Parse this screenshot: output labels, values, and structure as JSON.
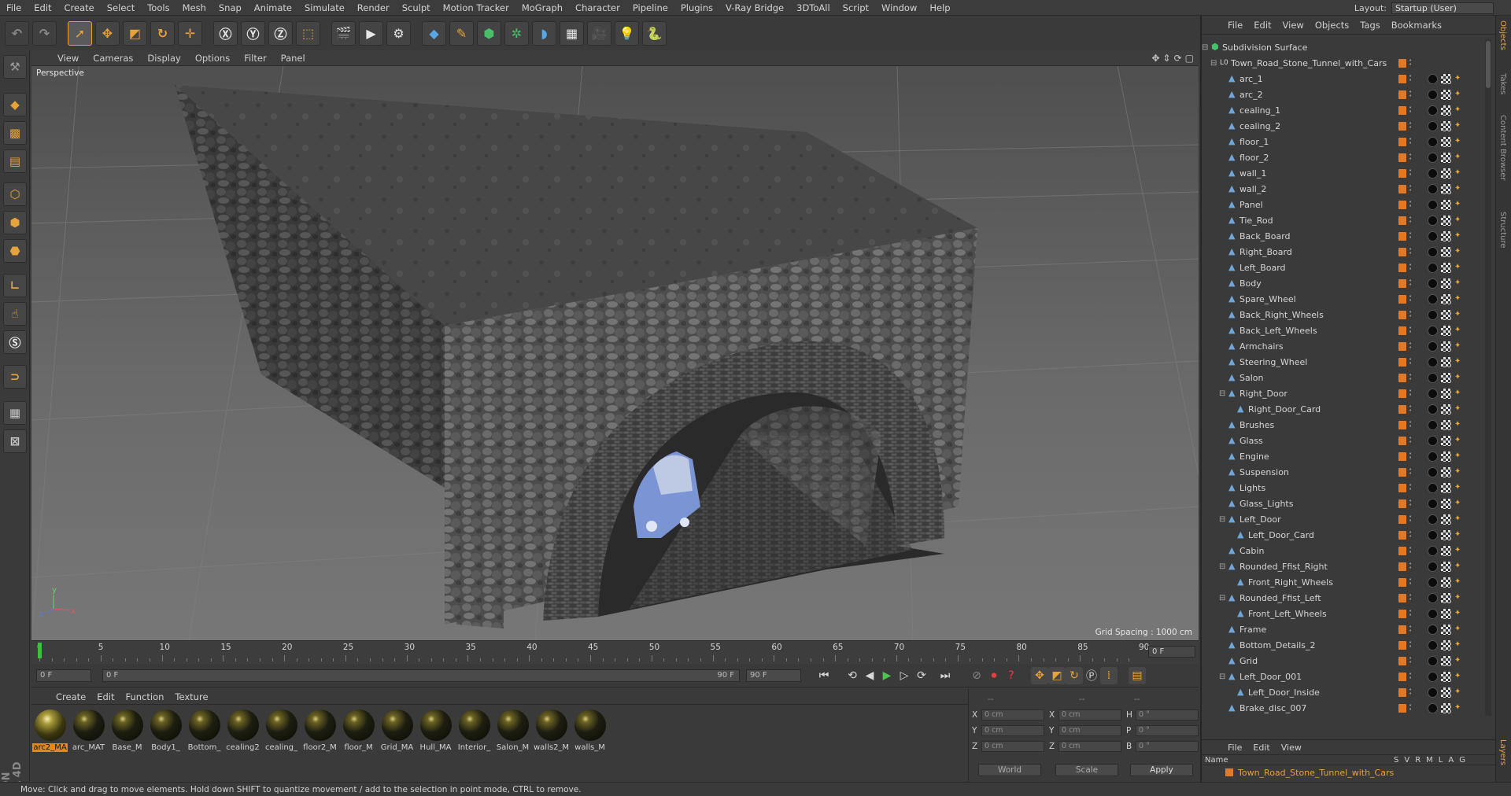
{
  "menu": [
    "File",
    "Edit",
    "Create",
    "Select",
    "Tools",
    "Mesh",
    "Snap",
    "Animate",
    "Simulate",
    "Render",
    "Sculpt",
    "Motion Tracker",
    "MoGraph",
    "Character",
    "Pipeline",
    "Plugins",
    "V-Ray Bridge",
    "3DToAll",
    "Script",
    "Window",
    "Help"
  ],
  "layout": {
    "label": "Layout:",
    "value": "Startup (User)"
  },
  "viewport": {
    "menu": [
      "View",
      "Cameras",
      "Display",
      "Options",
      "Filter",
      "Panel"
    ],
    "label": "Perspective",
    "grid_spacing": "Grid Spacing : 1000 cm"
  },
  "timeline": {
    "ticks": [
      "0",
      "5",
      "10",
      "15",
      "20",
      "25",
      "30",
      "35",
      "40",
      "45",
      "50",
      "55",
      "60",
      "65",
      "70",
      "75",
      "80",
      "85",
      "90"
    ],
    "current_frame": "0 F"
  },
  "transport": {
    "start_field": "0 F",
    "range_start": "0 F",
    "range_end": "90 F",
    "end_field": "90 F"
  },
  "material_menu": [
    "Create",
    "Edit",
    "Function",
    "Texture"
  ],
  "materials": [
    "arc2_MA",
    "arc_MAT",
    "Base_M",
    "Body1_",
    "Bottom_",
    "cealing2",
    "cealing_",
    "floor2_M",
    "floor_M",
    "Grid_MA",
    "Hull_MA",
    "Interior_",
    "Salon_M",
    "walls2_M",
    "walls_M"
  ],
  "attributes": {
    "header": "--",
    "pos_labels": [
      "X",
      "Y",
      "Z"
    ],
    "size_labels": [
      "X",
      "Y",
      "Z"
    ],
    "rot_labels": [
      "H",
      "P",
      "B"
    ],
    "pos_values": [
      "0 cm",
      "0 cm",
      "0 cm"
    ],
    "size_values": [
      "0 cm",
      "0 cm",
      "0 cm"
    ],
    "rot_values": [
      "0 °",
      "0 °",
      "0 °"
    ],
    "coord_system": "World",
    "mode": "Scale",
    "apply": "Apply"
  },
  "status": "Move: Click and drag to move elements. Hold down SHIFT to quantize movement / add to the selection in point mode, CTRL to remove.",
  "objects_menu": [
    "File",
    "Edit",
    "View",
    "Objects",
    "Tags",
    "Bookmarks"
  ],
  "tree": [
    {
      "name": "Subdivision Surface",
      "level": 0
    },
    {
      "name": "Town_Road_Stone_Tunnel_with_Cars",
      "level": 1
    },
    {
      "name": "arc_1",
      "level": 2
    },
    {
      "name": "arc_2",
      "level": 2
    },
    {
      "name": "cealing_1",
      "level": 2
    },
    {
      "name": "cealing_2",
      "level": 2
    },
    {
      "name": "floor_1",
      "level": 2
    },
    {
      "name": "floor_2",
      "level": 2
    },
    {
      "name": "wall_1",
      "level": 2
    },
    {
      "name": "wall_2",
      "level": 2
    },
    {
      "name": "Panel",
      "level": 2
    },
    {
      "name": "Tie_Rod",
      "level": 2
    },
    {
      "name": "Back_Board",
      "level": 2
    },
    {
      "name": "Right_Board",
      "level": 2
    },
    {
      "name": "Left_Board",
      "level": 2
    },
    {
      "name": "Body",
      "level": 2
    },
    {
      "name": "Spare_Wheel",
      "level": 2
    },
    {
      "name": "Back_Right_Wheels",
      "level": 2
    },
    {
      "name": "Back_Left_Wheels",
      "level": 2
    },
    {
      "name": "Armchairs",
      "level": 2
    },
    {
      "name": "Steering_Wheel",
      "level": 2
    },
    {
      "name": "Salon",
      "level": 2
    },
    {
      "name": "Right_Door",
      "level": 2
    },
    {
      "name": "Right_Door_Card",
      "level": 3
    },
    {
      "name": "Brushes",
      "level": 2
    },
    {
      "name": "Glass",
      "level": 2
    },
    {
      "name": "Engine",
      "level": 2
    },
    {
      "name": "Suspension",
      "level": 2
    },
    {
      "name": "Lights",
      "level": 2
    },
    {
      "name": "Glass_Lights",
      "level": 2
    },
    {
      "name": "Left_Door",
      "level": 2
    },
    {
      "name": "Left_Door_Card",
      "level": 3
    },
    {
      "name": "Cabin",
      "level": 2
    },
    {
      "name": "Rounded_Ffist_Right",
      "level": 2
    },
    {
      "name": "Front_Right_Wheels",
      "level": 3
    },
    {
      "name": "Rounded_Ffist_Left",
      "level": 2
    },
    {
      "name": "Front_Left_Wheels",
      "level": 3
    },
    {
      "name": "Frame",
      "level": 2
    },
    {
      "name": "Bottom_Details_2",
      "level": 2
    },
    {
      "name": "Grid",
      "level": 2
    },
    {
      "name": "Left_Door_001",
      "level": 2
    },
    {
      "name": "Left_Door_Inside",
      "level": 3
    },
    {
      "name": "Brake_disc_007",
      "level": 2
    }
  ],
  "layers": {
    "menu": [
      "File",
      "Edit",
      "View"
    ],
    "header_name": "Name",
    "header_cols": [
      "S",
      "V",
      "R",
      "M",
      "L",
      "A",
      "G"
    ],
    "row": "Town_Road_Stone_Tunnel_with_Cars"
  },
  "side_tabs": [
    "Objects",
    "Takes",
    "Content Browser",
    "Structure",
    "Layers"
  ],
  "colors": {
    "accent": "#e8a23a",
    "object_color": "#e07a28",
    "layer_text": "#e8a23a"
  }
}
